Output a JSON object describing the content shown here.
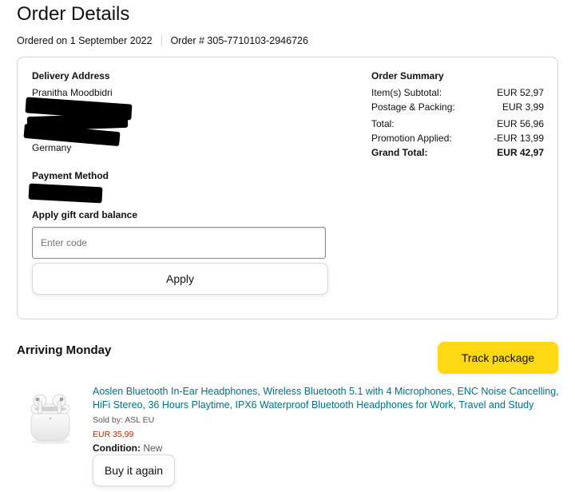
{
  "header": {
    "title": "Order Details",
    "ordered_on": "Ordered on 1 September 2022",
    "order_number": "Order # 305-7710103-2946726"
  },
  "delivery": {
    "heading": "Delivery Address",
    "name": "Pranitha Moodbidri",
    "country": "Germany"
  },
  "payment": {
    "heading": "Payment Method",
    "gift_card_heading": "Apply gift card balance",
    "code_placeholder": "Enter code",
    "apply_label": "Apply"
  },
  "summary": {
    "heading": "Order Summary",
    "rows": [
      {
        "label": "Item(s) Subtotal:",
        "value": "EUR 52,97"
      },
      {
        "label": "Postage & Packing:",
        "value": "EUR 3,99"
      },
      {
        "label": "Total:",
        "value": "EUR 56,96"
      },
      {
        "label": "Promotion Applied:",
        "value": "-EUR 13,99"
      },
      {
        "label": "Grand Total:",
        "value": "EUR 42,97"
      }
    ]
  },
  "shipment": {
    "status": "Arriving Monday",
    "track_label": "Track package",
    "item": {
      "image_icon": "earbuds-product-image",
      "title": "Aoslen Bluetooth In-Ear Headphones, Wireless Bluetooth 5.1 with 4 Microphones, ENC Noise Cancelling, HiFi Stereo, 36 Hours Playtime, IPX6 Waterproof Bluetooth Headphones for Work, Travel and Study",
      "sold_by": "Sold by: ASL EU",
      "price": "EUR 35,99",
      "condition_label": "Condition:",
      "condition_value": "New",
      "buy_again_label": "Buy it again"
    }
  },
  "colors": {
    "link": "#007185",
    "price": "#b12704",
    "track_button": "#ffd814",
    "border": "#d5d9d9"
  }
}
